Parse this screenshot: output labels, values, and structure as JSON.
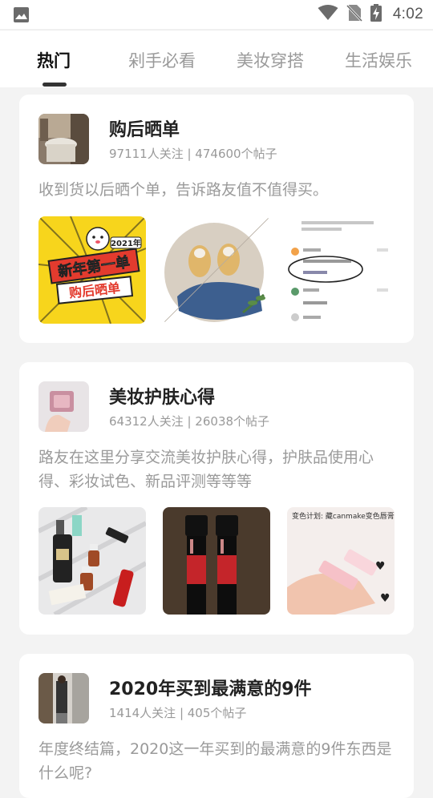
{
  "status_bar": {
    "time": "4:02"
  },
  "tabs": [
    {
      "label": "热门",
      "active": true
    },
    {
      "label": "剁手必看",
      "active": false
    },
    {
      "label": "美妆穿搭",
      "active": false
    },
    {
      "label": "生活娱乐",
      "active": false
    }
  ],
  "topics": [
    {
      "title": "购后晒单",
      "stats": "97111人关注 | 474600个帖子",
      "description": "收到货以后晒个单，告诉路友值不值得买。",
      "thumb1_text": {
        "year": "2021年",
        "line1": "新年第一单",
        "line2": "购后晒单"
      }
    },
    {
      "title": "美妆护肤心得",
      "stats": "64312人关注 | 26038个帖子",
      "description": "路友在这里分享交流美妆护肤心得，护肤品使用心得、彩妆试色、新品评测等等等",
      "thumb3_text": "变色计划: 藏canmake变色唇膏使用一期!"
    },
    {
      "title": "2020年买到最满意的9件",
      "stats": "1414人关注 | 405个帖子",
      "description": "年度终结篇，2020这一年买到的最满意的9件东西是什么呢?"
    }
  ]
}
